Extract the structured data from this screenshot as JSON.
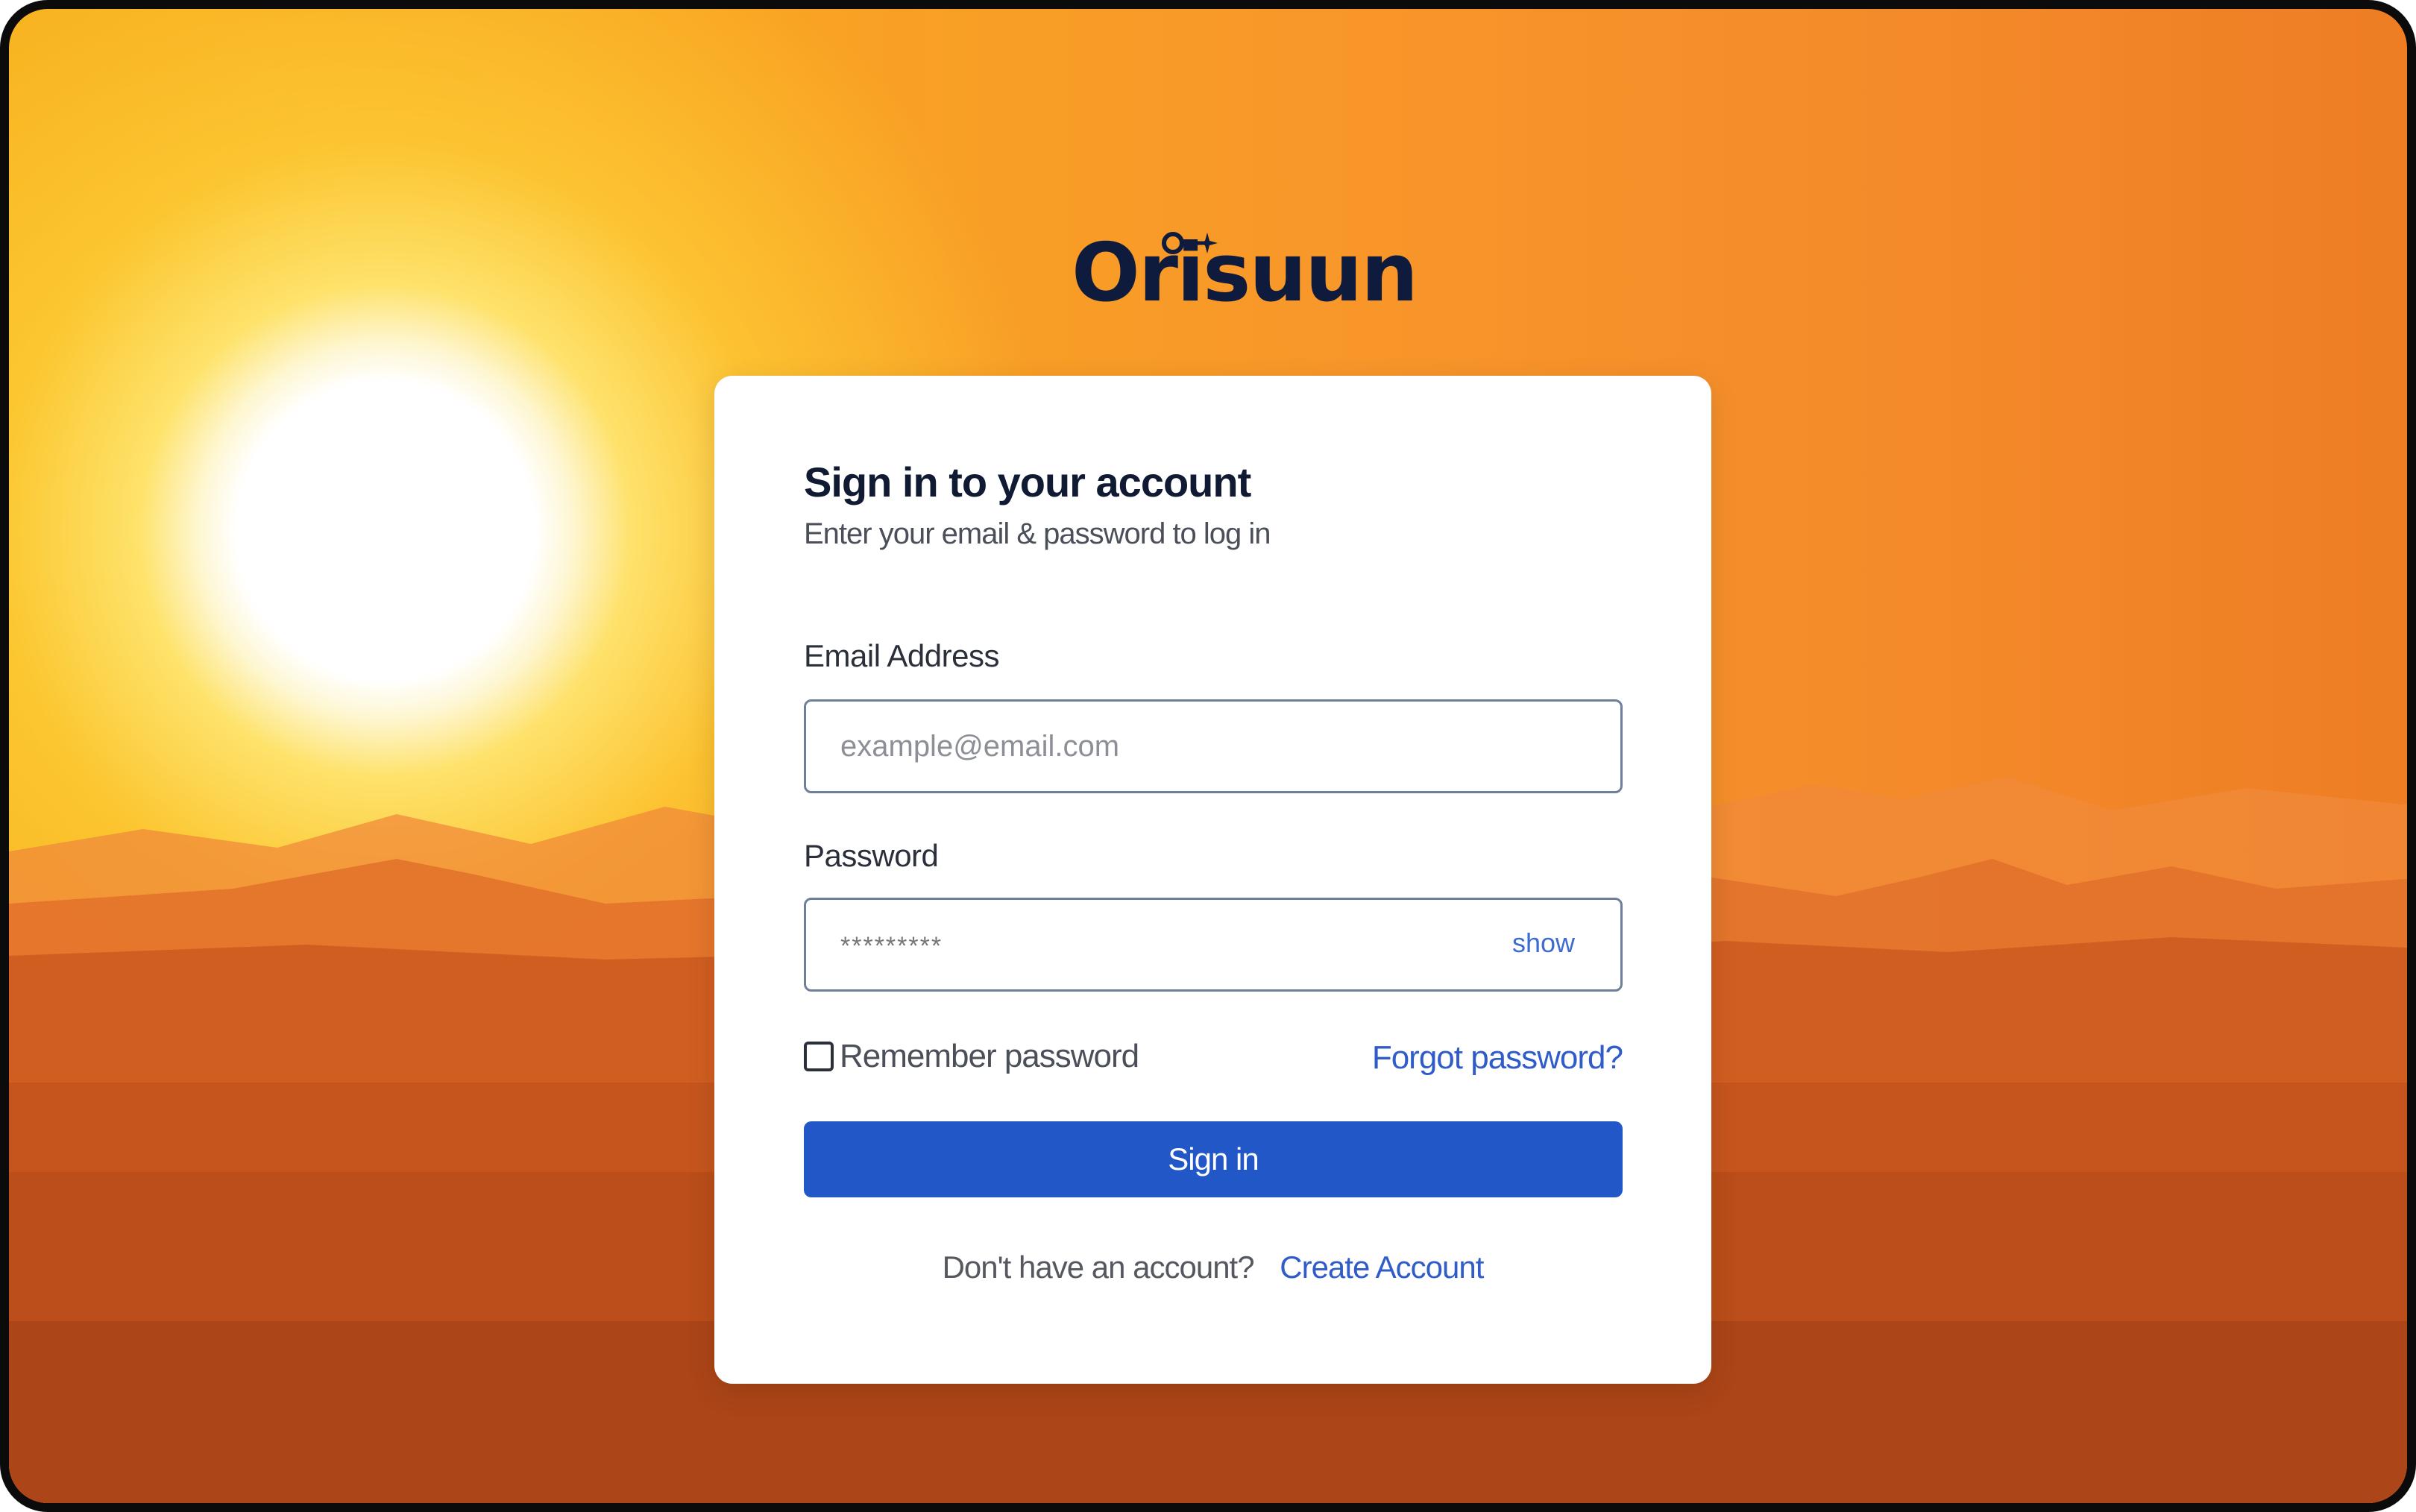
{
  "brand": {
    "name": "Orisuun",
    "trademark": "™",
    "color": "#0f1b3d"
  },
  "form": {
    "title": "Sign in to your account",
    "subtitle": "Enter your email & password to log in",
    "email": {
      "label": "Email Address",
      "placeholder": "example@email.com",
      "value": ""
    },
    "password": {
      "label": "Password",
      "placeholder": "*********",
      "value": "",
      "toggle_label": "show"
    },
    "remember": {
      "label": "Remember password",
      "checked": false
    },
    "forgot_label": "Forgot password?",
    "submit_label": "Sign in",
    "footer": {
      "prompt": "Don't have an account?",
      "link_label": "Create Account"
    }
  },
  "colors": {
    "primary": "#2157c6",
    "link": "#2f5cc9",
    "background_sky": "#f8972a"
  }
}
